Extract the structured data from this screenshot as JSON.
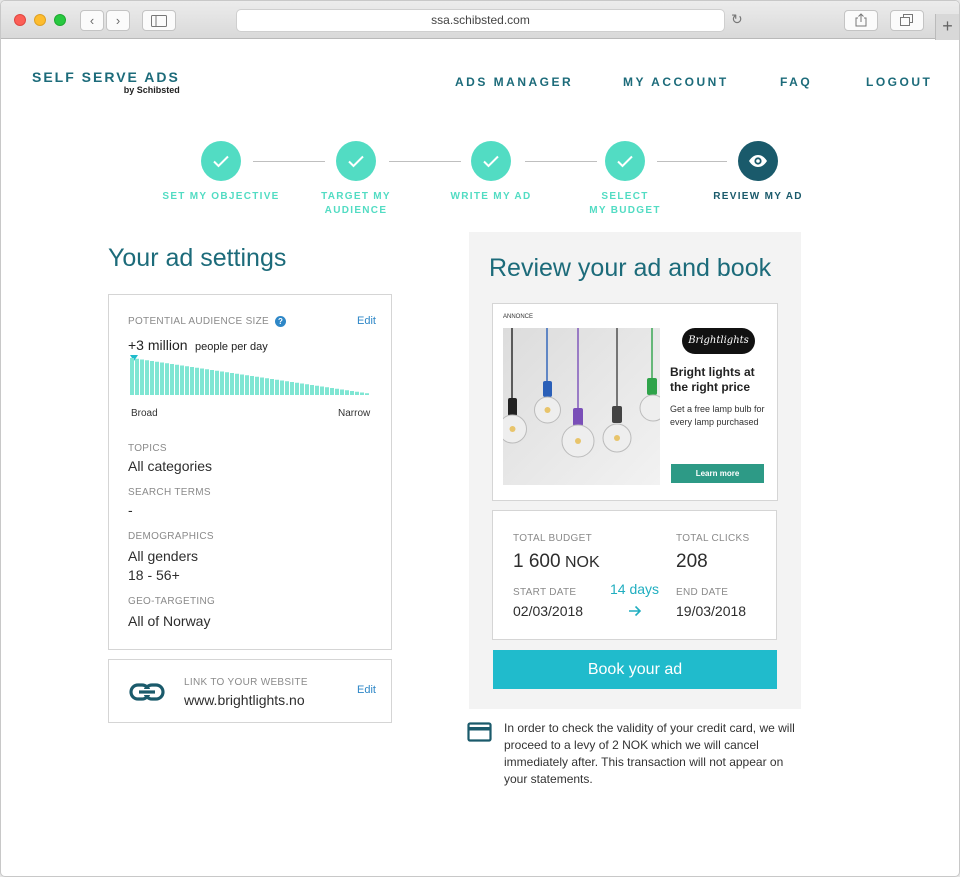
{
  "browser": {
    "url": "ssa.schibsted.com"
  },
  "brand": {
    "name": "SELF SERVE ADS",
    "by": "by Schibsted"
  },
  "nav": {
    "items": [
      "ADS MANAGER",
      "MY ACCOUNT",
      "FAQ",
      "LOGOUT"
    ]
  },
  "steps": [
    {
      "label1": "SET MY OBJECTIVE",
      "label2": ""
    },
    {
      "label1": "TARGET MY",
      "label2": "AUDIENCE"
    },
    {
      "label1": "WRITE MY AD",
      "label2": ""
    },
    {
      "label1": "SELECT",
      "label2": "MY BUDGET"
    },
    {
      "label1": "REVIEW MY AD",
      "label2": ""
    }
  ],
  "settings": {
    "title": "Your ad settings",
    "audience_label": "POTENTIAL AUDIENCE SIZE",
    "edit": "Edit",
    "audience_value": "+3 million",
    "audience_unit": "people per day",
    "broad": "Broad",
    "narrow": "Narrow",
    "topics_label": "TOPICS",
    "topics_value": "All categories",
    "search_label": "SEARCH TERMS",
    "search_value": "-",
    "demo_label": "DEMOGRAPHICS",
    "demo_gender": "All genders",
    "demo_age": "18 - 56+",
    "geo_label": "GEO-TARGETING",
    "geo_value": "All of Norway",
    "link_label": "LINK TO YOUR WEBSITE",
    "link_value": "www.brightlights.no",
    "link_edit": "Edit"
  },
  "review": {
    "title": "Review your ad and book",
    "ad_tag": "ANNONCE",
    "ad_logo": "Brightlights",
    "ad_headline": "Bright lights at the right price",
    "ad_body": "Get a free lamp bulb for every lamp purchased",
    "ad_cta": "Learn more",
    "total_budget_label": "TOTAL BUDGET",
    "total_budget_amount": "1 600",
    "total_budget_currency": "NOK",
    "total_clicks_label": "TOTAL CLICKS",
    "total_clicks_value": "208",
    "start_label": "START DATE",
    "start_value": "02/03/2018",
    "duration": "14 days",
    "end_label": "END DATE",
    "end_value": "19/03/2018",
    "book_label": "Book your ad",
    "notice": "In order to check the validity of your credit card, we will proceed to a levy of 2 NOK which we will cancel immediately after. This transaction will not appear on your statements."
  },
  "colors": {
    "brand": "#1c6b7a",
    "step_done": "#52dcc3",
    "step_active": "#1a5a6b",
    "book_button": "#20bbcc",
    "cta": "#2d9a86"
  }
}
